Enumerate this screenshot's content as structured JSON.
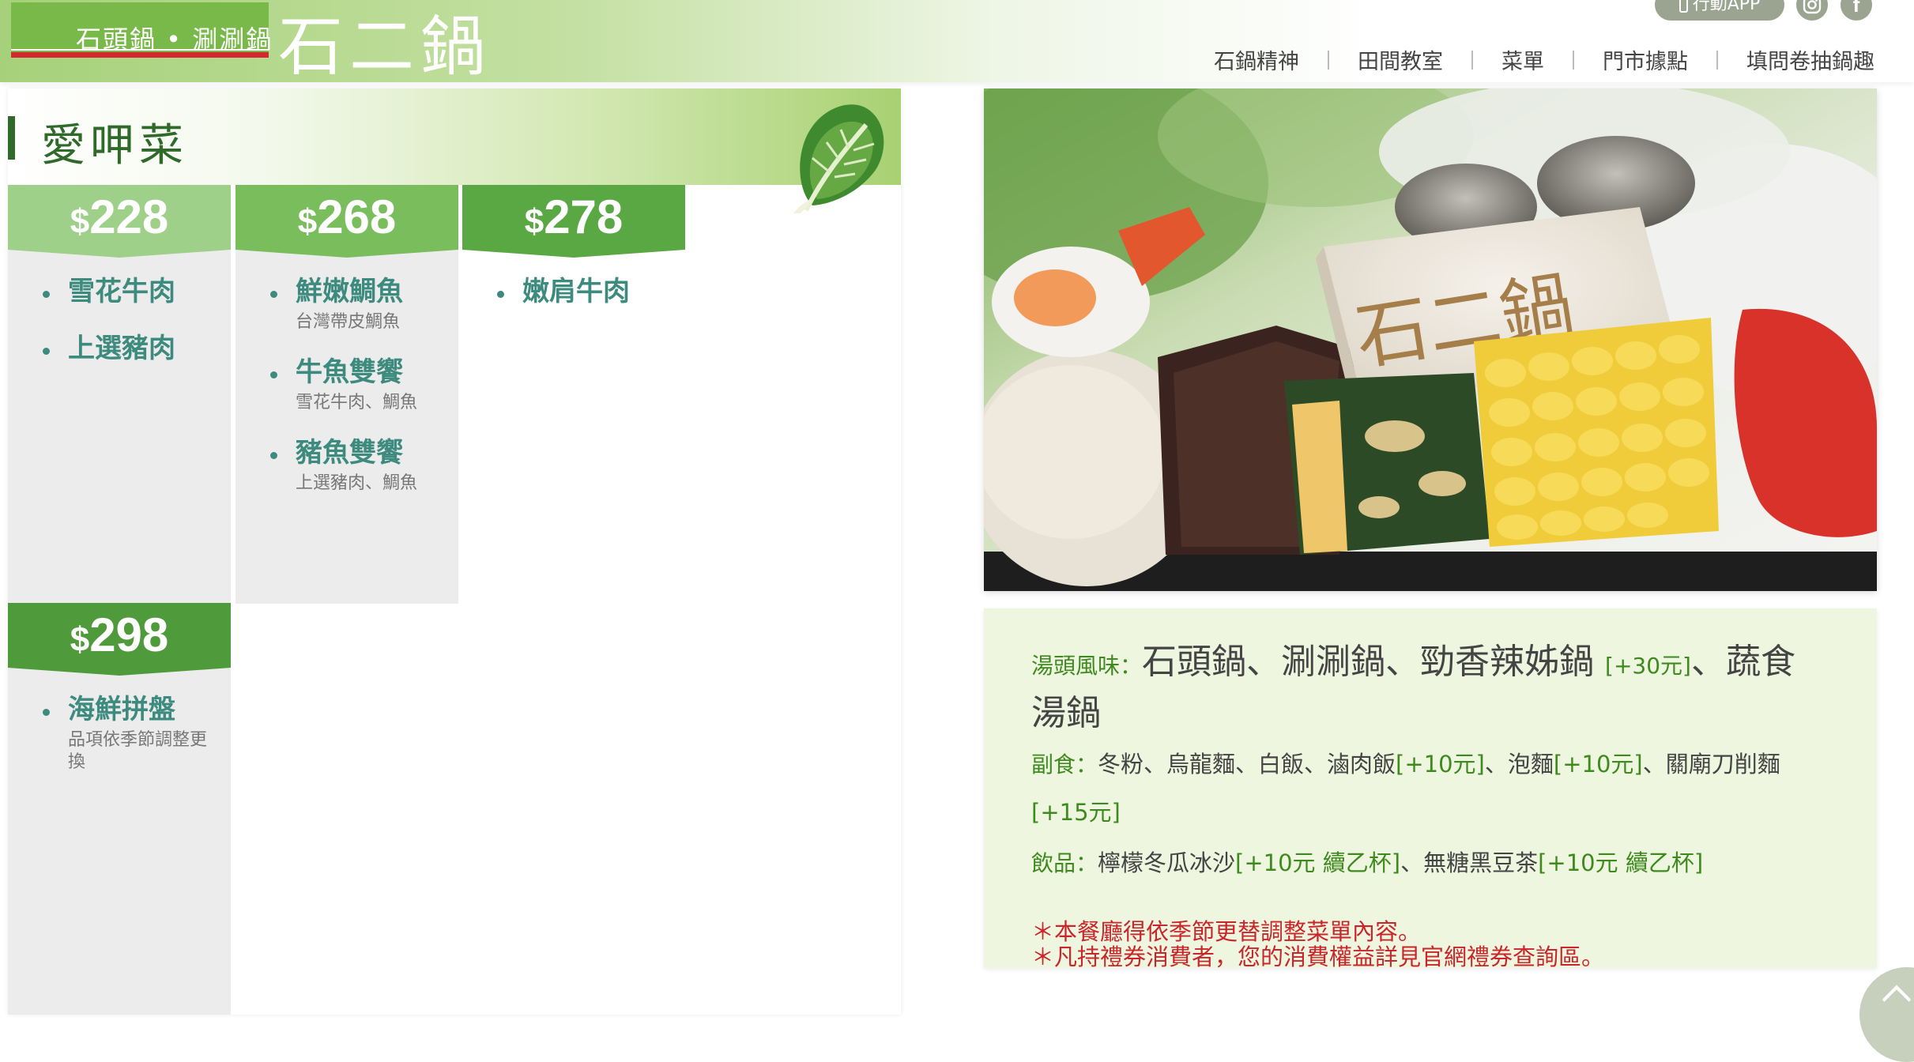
{
  "header": {
    "logo_tag": "石頭鍋 • 涮涮鍋",
    "logo_main": "石二鍋",
    "app_button": "行動APP",
    "nav": [
      "石鍋精神",
      "田間教室",
      "菜單",
      "門市據點",
      "填問卷抽鍋趣"
    ]
  },
  "menu": {
    "title": "愛呷菜",
    "tiers": [
      {
        "currency": "$",
        "price": "228",
        "items": [
          {
            "name": "雪花牛肉",
            "note": ""
          },
          {
            "name": "上選豬肉",
            "note": ""
          }
        ]
      },
      {
        "currency": "$",
        "price": "268",
        "items": [
          {
            "name": "鮮嫩鯛魚",
            "note": "台灣帶皮鯛魚"
          },
          {
            "name": "牛魚雙饗",
            "note": "雪花牛肉、鯛魚"
          },
          {
            "name": "豬魚雙饗",
            "note": "上選豬肉、鯛魚"
          }
        ]
      },
      {
        "currency": "$",
        "price": "278",
        "items": [
          {
            "name": "嫩肩牛肉",
            "note": ""
          }
        ]
      },
      {
        "currency": "$",
        "price": "298",
        "items": [
          {
            "name": "海鮮拼盤",
            "note": "品項依季節調整更換"
          }
        ]
      }
    ]
  },
  "photo": {
    "tofu_text": "石二鍋"
  },
  "info": {
    "soup_label": "湯頭風味：",
    "soup_main": "石頭鍋、涮涮鍋、勁香辣姊鍋",
    "soup_add": "[+30元]",
    "soup_rest": "、蔬食湯鍋",
    "side_label": "副食：",
    "side_a": "冬粉、烏龍麵、白飯、滷肉飯",
    "side_a_add": "[+10元]",
    "side_b": "、泡麵",
    "side_b_add": "[+10元]",
    "side_c": "、關廟刀削麵",
    "side_c_add": "[+15元]",
    "drink_label": "飲品：",
    "drink_a": "檸檬冬瓜冰沙",
    "drink_a_add": "[+10元 續乙杯]",
    "drink_b": "、無糖黑豆茶",
    "drink_b_add": "[+10元 續乙杯]",
    "note_1": "＊本餐廳得依季節更替調整菜單內容。",
    "note_2": "＊凡持禮券消費者，您的消費權益詳見官網禮券查詢區。"
  },
  "colors": {
    "brand_green": "#78b94a",
    "dark_green": "#2f6a2a",
    "item_teal": "#3d8a7e",
    "price_light": "#9fd08a",
    "price_mid": "#79bd5c",
    "price_dark": "#4f9a3a",
    "notice_red": "#c9262b"
  }
}
